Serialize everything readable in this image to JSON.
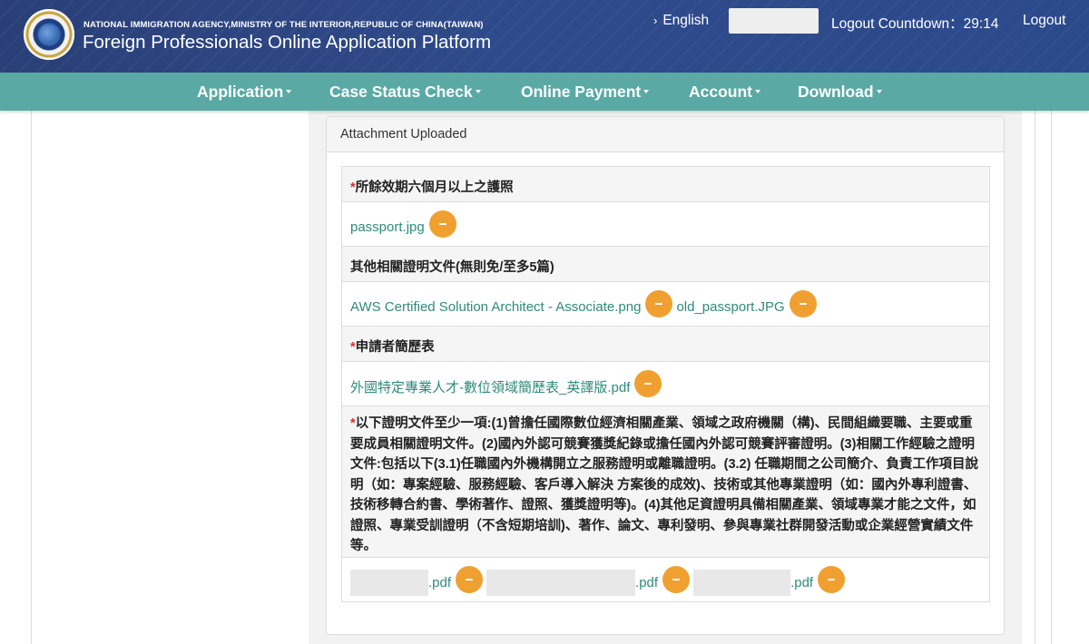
{
  "header": {
    "agency_line": "NATIONAL IMMIGRATION AGENCY,MINISTRY OF THE INTERIOR,REPUBLIC OF CHINA(TAIWAN)",
    "platform_title": "Foreign Professionals Online Application Platform",
    "language_label": "English",
    "countdown_label": "Logout Countdown：29:14",
    "logout_label": "Logout"
  },
  "nav": {
    "items": [
      {
        "label": "Application"
      },
      {
        "label": "Case Status Check"
      },
      {
        "label": "Online Payment"
      },
      {
        "label": "Account"
      },
      {
        "label": "Download"
      }
    ]
  },
  "panel": {
    "title": "Attachment Uploaded",
    "sections": [
      {
        "required": "*",
        "label": "所餘效期六個月以上之護照",
        "files": [
          "passport.jpg"
        ]
      },
      {
        "required": "",
        "label": "其他相關證明文件(無則免/至多5篇)",
        "files": [
          "AWS Certified Solution Architect - Associate.png",
          "old_passport.JPG"
        ]
      },
      {
        "required": "*",
        "label": "申請者簡歷表",
        "files": [
          "外國特定專業人才-數位領域簡歷表_英譯版.pdf"
        ]
      },
      {
        "required": "*",
        "label": "以下證明文件至少一項:(1)曾擔任國際數位經濟相關產業、領域之政府機關（構)、民間組織要職、主要或重要成員相關證明文件。(2)國內外認可競賽獲獎紀錄或擔任國內外認可競賽評審證明。(3)相關工作經驗之證明文件:包括以下(3.1)任職國內外機構開立之服務證明或離職證明。(3.2) 任職期間之公司簡介、負責工作項目說明（如：專案經驗、服務經驗、客戶導入解決 方案後的成效)、技術或其他專業證明（如：國內外專利證書、技術移轉合約書、學術著作、證照、獲獎證明等)。(4)其他足資證明具備相關產業、領域專業才能之文件，如證照、專業受訓證明（不含短期培訓)、著作、論文、專利發明、參與專業社群開發活動或企業經營實績文件等。",
        "files": [
          ".pdf",
          ".pdf",
          ".pdf"
        ]
      }
    ]
  },
  "colors": {
    "header_bg": "#2b4a8c",
    "nav_bg": "#5aa9a4",
    "link": "#2e8b7c",
    "remove_button": "#f0a030",
    "required_mark": "#d9302c"
  }
}
